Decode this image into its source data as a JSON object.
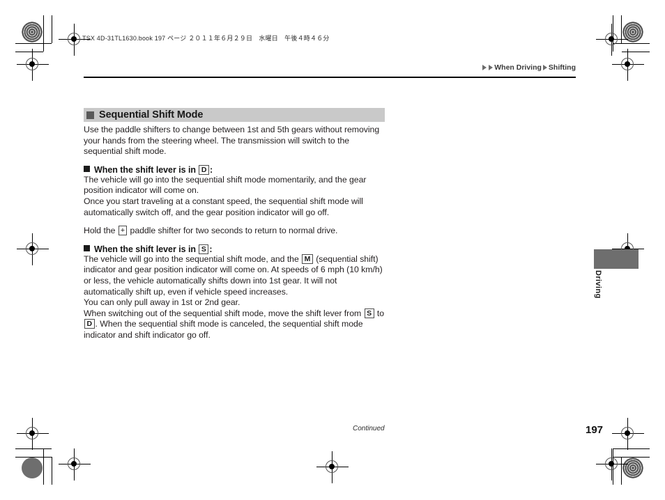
{
  "print_header": {
    "text": "TSX 4D-31TL1630.book   197 ページ   ２０１１年６月２９日　水曜日　午後４時４６分"
  },
  "breadcrumb": {
    "section": "When Driving",
    "subsection": "Shifting"
  },
  "section": {
    "title": "Sequential Shift Mode"
  },
  "content": {
    "intro": "Use the paddle shifters to change between 1st and 5th gears without removing your hands from the steering wheel. The transmission will switch to the sequential shift mode.",
    "subhead_d_prefix": "When the shift lever is in",
    "subhead_d_icon": "D",
    "subhead_d_suffix": ":",
    "para_d_1": "The vehicle will go into the sequential shift mode momentarily, and the gear position indicator will come on.",
    "para_d_2": "Once you start traveling at a constant speed, the sequential shift mode will automatically switch off, and the gear position indicator will go off.",
    "hold_prefix": "Hold the",
    "hold_icon": "+",
    "hold_suffix": "paddle shifter for two seconds to return to normal drive.",
    "subhead_s_prefix": "When the shift lever is in",
    "subhead_s_icon": "S",
    "subhead_s_suffix": ":",
    "para_s_1a": "The vehicle will go into the sequential shift mode, and the",
    "para_s_1_icon": "M",
    "para_s_1b": "(sequential shift) indicator and gear position indicator will come on. At speeds of 6 mph (10 km/h) or less, the vehicle automatically shifts down into 1st gear. It will not automatically shift up, even if vehicle speed increases.",
    "para_s_2": "You can only pull away in 1st or 2nd gear.",
    "para_s_3a": "When switching out of the sequential shift mode, move the shift lever from",
    "para_s_3_icon_1": "S",
    "para_s_3b": "to",
    "para_s_3_icon_2": "D",
    "para_s_3c": ". When the sequential shift mode is canceled, the sequential shift mode indicator and shift indicator go off."
  },
  "side_tab": {
    "label": "Driving"
  },
  "footer": {
    "continued": "Continued",
    "page_number": "197"
  }
}
